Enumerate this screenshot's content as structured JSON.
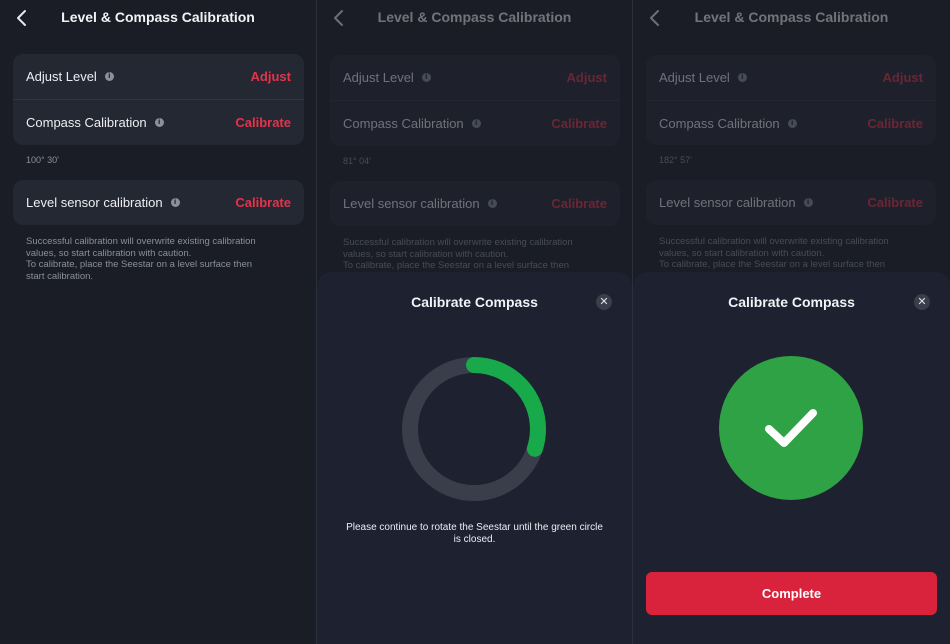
{
  "colors": {
    "accent": "#e5334b",
    "success": "#2ea244",
    "progress": "#17a94a",
    "button": "#d9233d"
  },
  "header": {
    "title": "Level & Compass Calibration"
  },
  "rows": {
    "adjust_level": {
      "label": "Adjust Level",
      "action": "Adjust"
    },
    "compass": {
      "label": "Compass Calibration",
      "action": "Calibrate"
    },
    "level_sensor": {
      "label": "Level sensor calibration",
      "action": "Calibrate"
    }
  },
  "panels": [
    {
      "heading": "100° 30'"
    },
    {
      "heading": "81° 04'"
    },
    {
      "heading": "182° 57'"
    }
  ],
  "note": {
    "line1": "Successful calibration will overwrite existing calibration",
    "line2": "values, so start calibration with caution.",
    "line3": "To calibrate, place the Seestar on a level surface then",
    "line4": "start  calibration."
  },
  "dialog": {
    "title": "Calibrate Compass",
    "progress": 0.3,
    "message_line1": "Please continue to rotate the Seestar until the green circle",
    "message_line2": "is closed.",
    "complete_label": "Complete"
  }
}
